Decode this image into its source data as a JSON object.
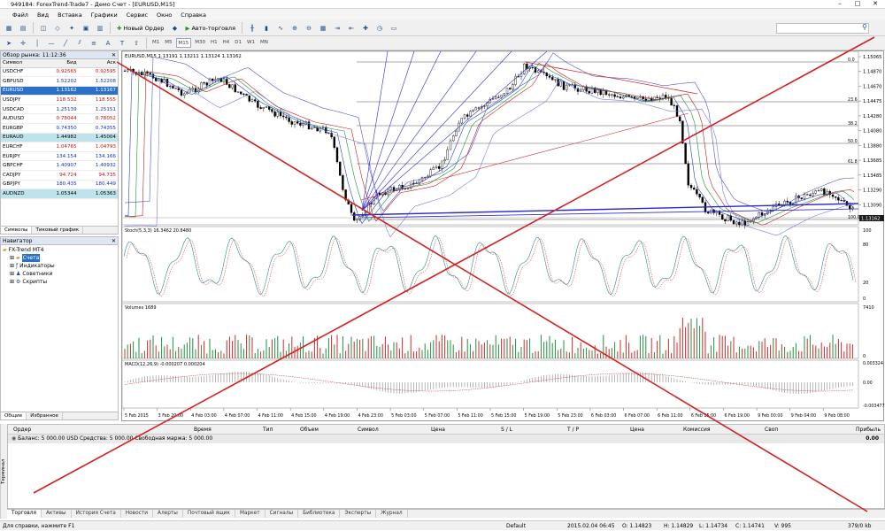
{
  "window": {
    "title": "949184: ForexTrend-Trade7 - Демо Счет - [EURUSD,M15]"
  },
  "menu": [
    "Файл",
    "Вид",
    "Вставка",
    "Графики",
    "Сервис",
    "Окно",
    "Справка"
  ],
  "toolbar": {
    "new_order": "Новый Ордер",
    "auto_trading": "Авто-торговля"
  },
  "timeframes": [
    "M1",
    "M5",
    "M15",
    "M30",
    "H1",
    "H4",
    "D1",
    "W1",
    "MN"
  ],
  "market_watch": {
    "title": "Обзор рынка: 11:12:36",
    "headers": {
      "symbol": "Символ",
      "bid": "Бид",
      "ask": "Аск"
    },
    "rows": [
      {
        "symbol": "USDCHF",
        "bid": "0.92565",
        "ask": "0.92595",
        "dir": "dn"
      },
      {
        "symbol": "GBPUSD",
        "bid": "1.52202",
        "ask": "1.52208",
        "dir": "up"
      },
      {
        "symbol": "EURUSD",
        "bid": "1.13162",
        "ask": "1.13167",
        "dir": "sel"
      },
      {
        "symbol": "USDJPY",
        "bid": "118.532",
        "ask": "118.555",
        "dir": "dn"
      },
      {
        "symbol": "USDCAD",
        "bid": "1.25139",
        "ask": "1.25151",
        "dir": "up"
      },
      {
        "symbol": "AUDUSD",
        "bid": "0.78044",
        "ask": "0.78052",
        "dir": "dn"
      },
      {
        "symbol": "EURGBP",
        "bid": "0.74350",
        "ask": "0.74355",
        "dir": "up"
      },
      {
        "symbol": "EURAUD",
        "bid": "1.44982",
        "ask": "1.45004",
        "dir": "hl"
      },
      {
        "symbol": "EURCHF",
        "bid": "1.04765",
        "ask": "1.04793",
        "dir": "dn"
      },
      {
        "symbol": "EURJPY",
        "bid": "134.154",
        "ask": "134.166",
        "dir": "up"
      },
      {
        "symbol": "GBPCHF",
        "bid": "1.40907",
        "ask": "1.40932",
        "dir": "up"
      },
      {
        "symbol": "CADJPY",
        "bid": "94.724",
        "ask": "94.735",
        "dir": "dn"
      },
      {
        "symbol": "GBPJPY",
        "bid": "180.435",
        "ask": "180.449",
        "dir": "up"
      },
      {
        "symbol": "AUDNZD",
        "bid": "1.05344",
        "ask": "1.05363",
        "dir": "hl"
      }
    ],
    "tabs": [
      "Символы",
      "Тиковый график"
    ]
  },
  "navigator": {
    "title": "Навигатор",
    "items": [
      "FX-Trend MT4",
      "Счета",
      "Индикаторы",
      "Советники",
      "Скрипты"
    ],
    "tabs": [
      "Общие",
      "Избранное"
    ]
  },
  "chart": {
    "symbol_header": "EURUSD,M15  1.13191 1.13211 1.13124 1.13162",
    "price_scale": [
      "1.15065",
      "1.14870",
      "1.14670",
      "1.14475",
      "1.14280",
      "1.14080",
      "1.13880",
      "1.13685",
      "1.13485",
      "1.13290",
      "1.13090",
      "1.12895"
    ],
    "current_price": "1.13162",
    "fib_levels": [
      "0.0",
      "23.6",
      "38.2",
      "50.0",
      "61.8",
      "100.0"
    ],
    "stoch_label": "Stoch(5,3,3) 16.3462 20.8480",
    "stoch_scale": [
      "100",
      "80",
      "20",
      "0"
    ],
    "volume_label": "Volumes 1689",
    "volume_scale": [
      "7410",
      "0"
    ],
    "macd_label": "MACD(12,26,9) -0.000207 0.000204",
    "macd_scale": [
      "0.003324",
      "0.00",
      "-0.003477"
    ],
    "time_axis": [
      "5 Feb 2015",
      "3 Feb 20:00",
      "4 Feb 03:00",
      "4 Feb 07:00",
      "4 Feb 11:00",
      "4 Feb 15:00",
      "4 Feb 19:00",
      "4 Feb 23:00",
      "5 Feb 03:00",
      "5 Feb 07:00",
      "5 Feb 11:00",
      "5 Feb 15:00",
      "5 Feb 19:00",
      "5 Feb 23:00",
      "6 Feb 03:00",
      "6 Feb 07:00",
      "6 Feb 11:00",
      "6 Feb 15:00",
      "6 Feb 19:00",
      "9 Feb 00:00",
      "9 Feb 04:00",
      "9 Feb 08:00"
    ]
  },
  "terminal": {
    "headers": [
      "Ордер",
      "Время",
      "Тип",
      "Объем",
      "Символ",
      "Цена",
      "S / L",
      "T / P",
      "Цена",
      "Комиссия",
      "Своп",
      "Прибыль"
    ],
    "balance_line": "Баланс: 5 000.00 USD  Средства: 5 000.00  Свободная маржа: 5 000.00",
    "profit": "0.00",
    "tabs": [
      "Торговля",
      "Активы",
      "История Счета",
      "Новости",
      "Алерты",
      "Почтовый ящик",
      "Маркет",
      "Сигналы",
      "Библиотека",
      "Эксперты",
      "Журнал"
    ],
    "side_label": "Терминал"
  },
  "statusbar": {
    "help": "Для справки, нажмите F1",
    "profile": "Default",
    "datetime": "2015.02.04 06:45",
    "open": "O: 1.14823",
    "high": "H: 1.14829",
    "low": "L: 1.14734",
    "close": "C: 1.14741",
    "volume": "V: 995",
    "traffic": "379/0 kb"
  }
}
